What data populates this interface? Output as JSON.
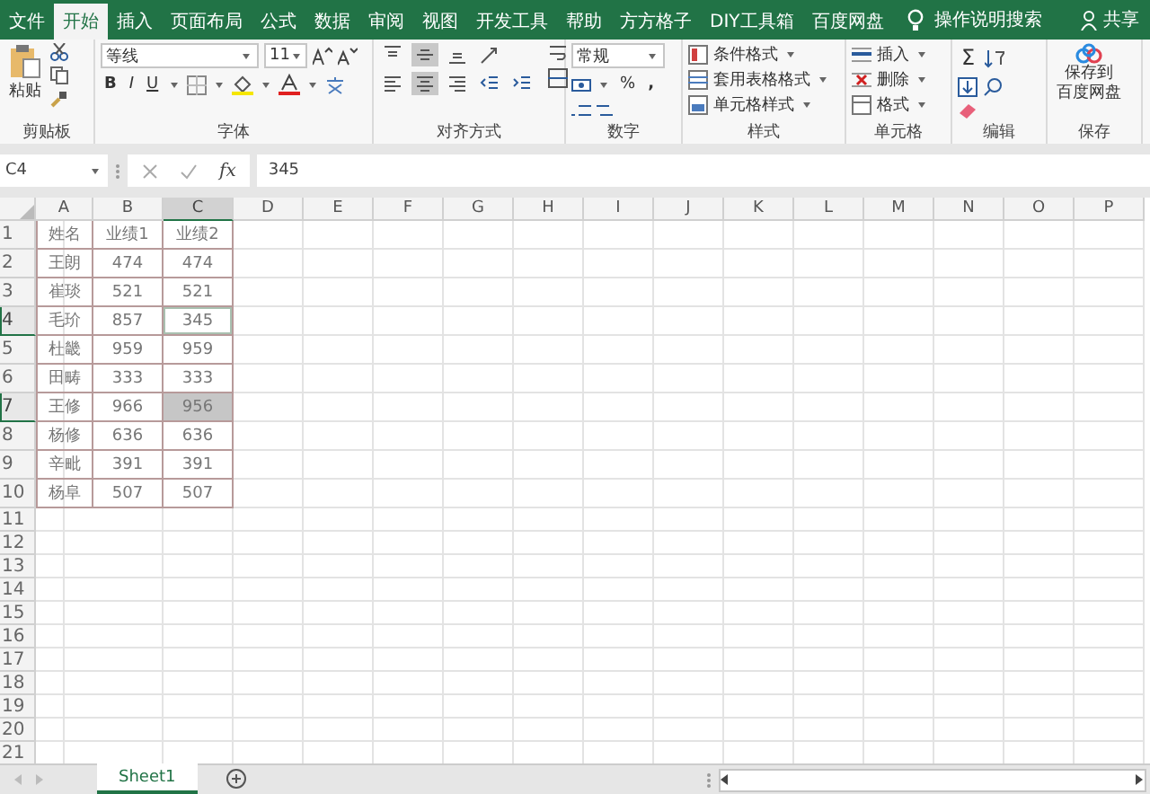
{
  "ribbon_tabs": [
    {
      "label": "文件",
      "selected": false
    },
    {
      "label": "开始",
      "selected": true
    },
    {
      "label": "插入",
      "selected": false
    },
    {
      "label": "页面布局",
      "selected": false
    },
    {
      "label": "公式",
      "selected": false
    },
    {
      "label": "数据",
      "selected": false
    },
    {
      "label": "审阅",
      "selected": false
    },
    {
      "label": "视图",
      "selected": false
    },
    {
      "label": "开发工具",
      "selected": false
    },
    {
      "label": "帮助",
      "selected": false
    },
    {
      "label": "方方格子",
      "selected": false
    },
    {
      "label": "DIY工具箱",
      "selected": false
    },
    {
      "label": "百度网盘",
      "selected": false
    }
  ],
  "tell_me": "操作说明搜索",
  "share": "共享",
  "ribbon": {
    "clipboard": {
      "paste": "粘贴",
      "label": "剪贴板"
    },
    "font": {
      "name": "等线",
      "size": "11",
      "bold": "B",
      "italic": "I",
      "underline": "U",
      "label": "字体"
    },
    "alignment": {
      "label": "对齐方式",
      "buttons": [
        {
          "kind": "top",
          "selected": false
        },
        {
          "kind": "middle",
          "selected": true
        },
        {
          "kind": "bottom",
          "selected": false
        },
        {
          "kind": "orientation",
          "selected": false
        },
        {
          "kind": "left",
          "selected": false
        },
        {
          "kind": "center",
          "selected": true
        },
        {
          "kind": "right",
          "selected": false
        },
        {
          "kind": "outdent",
          "selected": false
        },
        {
          "kind": "indent",
          "selected": false
        }
      ]
    },
    "number": {
      "format": "常规",
      "percent": "%",
      "comma": ",",
      "label": "数字"
    },
    "styles": {
      "items": [
        "条件格式",
        "套用表格格式",
        "单元格样式"
      ],
      "label": "样式"
    },
    "cells": {
      "items": [
        "插入",
        "删除",
        "格式"
      ],
      "label": "单元格"
    },
    "editing": {
      "sum": "Σ",
      "label": "编辑"
    },
    "save": {
      "button": [
        "保存到",
        "百度网盘"
      ],
      "label": "保存"
    }
  },
  "formula_bar": {
    "name_box": "C4",
    "function_label": "fx",
    "value": "345"
  },
  "columns": [
    {
      "label": "A",
      "selected": false
    },
    {
      "label": "B",
      "selected": false
    },
    {
      "label": "C",
      "selected": true
    },
    {
      "label": "D",
      "selected": false
    },
    {
      "label": "E",
      "selected": false
    },
    {
      "label": "F",
      "selected": false
    },
    {
      "label": "G",
      "selected": false
    },
    {
      "label": "H",
      "selected": false
    },
    {
      "label": "I",
      "selected": false
    },
    {
      "label": "J",
      "selected": false
    },
    {
      "label": "K",
      "selected": false
    },
    {
      "label": "L",
      "selected": false
    },
    {
      "label": "M",
      "selected": false
    },
    {
      "label": "N",
      "selected": false
    },
    {
      "label": "O",
      "selected": false
    },
    {
      "label": "P",
      "selected": false
    }
  ],
  "rows": [
    {
      "label": "1",
      "selected": false,
      "cells": [
        {
          "text": "姓名",
          "selected": false,
          "highlighted": false
        },
        {
          "text": "业绩1",
          "selected": false,
          "highlighted": false
        },
        {
          "text": "业绩2",
          "selected": false,
          "highlighted": false
        }
      ]
    },
    {
      "label": "2",
      "selected": false,
      "cells": [
        {
          "text": "王朗",
          "selected": false,
          "highlighted": false
        },
        {
          "text": "474",
          "selected": false,
          "highlighted": false
        },
        {
          "text": "474",
          "selected": false,
          "highlighted": false
        }
      ]
    },
    {
      "label": "3",
      "selected": false,
      "cells": [
        {
          "text": "崔琰",
          "selected": false,
          "highlighted": false
        },
        {
          "text": "521",
          "selected": false,
          "highlighted": false
        },
        {
          "text": "521",
          "selected": false,
          "highlighted": false
        }
      ]
    },
    {
      "label": "4",
      "selected": true,
      "cells": [
        {
          "text": "毛玠",
          "selected": false,
          "highlighted": false
        },
        {
          "text": "857",
          "selected": false,
          "highlighted": false
        },
        {
          "text": "345",
          "selected": true,
          "highlighted": false
        }
      ]
    },
    {
      "label": "5",
      "selected": false,
      "cells": [
        {
          "text": "杜畿",
          "selected": false,
          "highlighted": false
        },
        {
          "text": "959",
          "selected": false,
          "highlighted": false
        },
        {
          "text": "959",
          "selected": false,
          "highlighted": false
        }
      ]
    },
    {
      "label": "6",
      "selected": false,
      "cells": [
        {
          "text": "田畴",
          "selected": false,
          "highlighted": false
        },
        {
          "text": "333",
          "selected": false,
          "highlighted": false
        },
        {
          "text": "333",
          "selected": false,
          "highlighted": false
        }
      ]
    },
    {
      "label": "7",
      "selected": true,
      "cells": [
        {
          "text": "王修",
          "selected": false,
          "highlighted": false
        },
        {
          "text": "966",
          "selected": false,
          "highlighted": false
        },
        {
          "text": "956",
          "selected": false,
          "highlighted": true
        }
      ]
    },
    {
      "label": "8",
      "selected": false,
      "cells": [
        {
          "text": "杨修",
          "selected": false,
          "highlighted": false
        },
        {
          "text": "636",
          "selected": false,
          "highlighted": false
        },
        {
          "text": "636",
          "selected": false,
          "highlighted": false
        }
      ]
    },
    {
      "label": "9",
      "selected": false,
      "cells": [
        {
          "text": "辛毗",
          "selected": false,
          "highlighted": false
        },
        {
          "text": "391",
          "selected": false,
          "highlighted": false
        },
        {
          "text": "391",
          "selected": false,
          "highlighted": false
        }
      ]
    },
    {
      "label": "10",
      "selected": false,
      "cells": [
        {
          "text": "杨阜",
          "selected": false,
          "highlighted": false
        },
        {
          "text": "507",
          "selected": false,
          "highlighted": false
        },
        {
          "text": "507",
          "selected": false,
          "highlighted": false
        }
      ]
    },
    {
      "label": "11",
      "selected": false,
      "cells": []
    },
    {
      "label": "12",
      "selected": false,
      "cells": []
    },
    {
      "label": "13",
      "selected": false,
      "cells": []
    },
    {
      "label": "14",
      "selected": false,
      "cells": []
    },
    {
      "label": "15",
      "selected": false,
      "cells": []
    },
    {
      "label": "16",
      "selected": false,
      "cells": []
    },
    {
      "label": "17",
      "selected": false,
      "cells": []
    },
    {
      "label": "18",
      "selected": false,
      "cells": []
    },
    {
      "label": "19",
      "selected": false,
      "cells": []
    },
    {
      "label": "20",
      "selected": false,
      "cells": []
    },
    {
      "label": "21",
      "selected": false,
      "cells": []
    }
  ],
  "sheets": [
    {
      "label": "Sheet1",
      "selected": true
    }
  ]
}
